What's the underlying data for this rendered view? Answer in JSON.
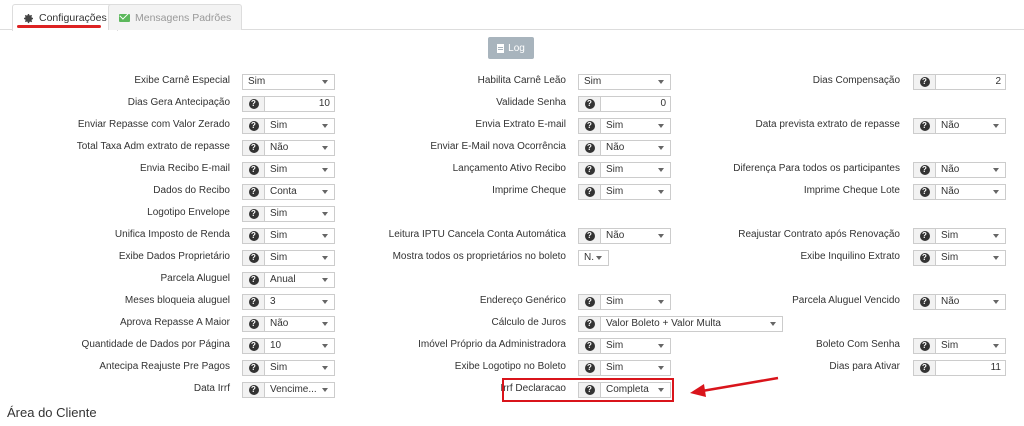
{
  "tabs": [
    {
      "label": "Configurações",
      "active": true
    },
    {
      "label": "Mensagens Padrões",
      "active": false
    }
  ],
  "log_button": "Log",
  "section_title": "Área do Cliente",
  "help_glyph": "?",
  "colors": {
    "accent_red": "#d9141b",
    "log_button": "#a8b4bd",
    "mail_green": "#5cb85c"
  },
  "rows": [
    [
      {
        "label": "Exibe Carnê Especial",
        "type": "select",
        "value": "Sim",
        "help": false
      },
      {
        "label": "Habilita Carnê Leão",
        "type": "select",
        "value": "Sim",
        "help": false
      },
      {
        "label": "Dias Compensação",
        "type": "number",
        "value": "2",
        "help": true
      }
    ],
    [
      {
        "label": "Dias Gera Antecipação",
        "type": "number",
        "value": "10",
        "help": true
      },
      {
        "label": "Validade Senha",
        "type": "number",
        "value": "0",
        "help": true
      },
      null
    ],
    [
      {
        "label": "Enviar Repasse com Valor Zerado",
        "type": "select",
        "value": "Sim",
        "help": true
      },
      {
        "label": "Envia Extrato E-mail",
        "type": "select",
        "value": "Sim",
        "help": true
      },
      {
        "label": "Data prevista extrato de repasse",
        "type": "select",
        "value": "Não",
        "help": true
      }
    ],
    [
      {
        "label": "Total Taxa Adm extrato de repasse",
        "type": "select",
        "value": "Não",
        "help": true
      },
      {
        "label": "Enviar E-Mail nova Ocorrência",
        "type": "select",
        "value": "Não",
        "help": true
      },
      null
    ],
    [
      {
        "label": "Envia Recibo E-mail",
        "type": "select",
        "value": "Sim",
        "help": true
      },
      {
        "label": "Lançamento Ativo Recibo",
        "type": "select",
        "value": "Sim",
        "help": true
      },
      {
        "label": "Diferença Para todos os participantes",
        "type": "select",
        "value": "Não",
        "help": true
      }
    ],
    [
      {
        "label": "Dados do Recibo",
        "type": "select",
        "value": "Conta",
        "help": true
      },
      {
        "label": "Imprime Cheque",
        "type": "select",
        "value": "Sim",
        "help": true
      },
      {
        "label": "Imprime Cheque Lote",
        "type": "select",
        "value": "Não",
        "help": true
      }
    ],
    [
      {
        "label": "Logotipo Envelope",
        "type": "select",
        "value": "Sim",
        "help": true
      },
      null,
      null
    ],
    [
      {
        "label": "Unifica Imposto de Renda",
        "type": "select",
        "value": "Sim",
        "help": true
      },
      {
        "label": "Leitura IPTU Cancela Conta Automática",
        "type": "select",
        "value": "Não",
        "help": true
      },
      {
        "label": "Reajustar Contrato após Renovação",
        "type": "select",
        "value": "Sim",
        "help": true
      }
    ],
    [
      {
        "label": "Exibe Dados Proprietário",
        "type": "select",
        "value": "Sim",
        "help": true
      },
      {
        "label": "Mostra todos os proprietários no boleto",
        "type": "select",
        "value": "N.",
        "help": false,
        "narrow": true
      },
      {
        "label": "Exibe Inquilino Extrato",
        "type": "select",
        "value": "Sim",
        "help": true
      }
    ],
    [
      {
        "label": "Parcela Aluguel",
        "type": "select",
        "value": "Anual",
        "help": true
      },
      null,
      null
    ],
    [
      {
        "label": "Meses bloqueia aluguel",
        "type": "select",
        "value": "3",
        "help": true
      },
      {
        "label": "Endereço Genérico",
        "type": "select",
        "value": "Sim",
        "help": true
      },
      {
        "label": "Parcela Aluguel Vencido",
        "type": "select",
        "value": "Não",
        "help": true
      }
    ],
    [
      {
        "label": "Aprova Repasse A Maior",
        "type": "select",
        "value": "Não",
        "help": true
      },
      {
        "label": "Cálculo de Juros",
        "type": "select",
        "value": "Valor Boleto + Valor Multa",
        "help": true,
        "wide": true
      },
      null
    ],
    [
      {
        "label": "Quantidade de Dados por Página",
        "type": "select",
        "value": "10",
        "help": true
      },
      {
        "label": "Imóvel Próprio da Administradora",
        "type": "select",
        "value": "Sim",
        "help": true
      },
      {
        "label": "Boleto Com Senha",
        "type": "select",
        "value": "Sim",
        "help": true
      }
    ],
    [
      {
        "label": "Antecipa Reajuste Pre Pagos",
        "type": "select",
        "value": "Sim",
        "help": true
      },
      {
        "label": "Exibe Logotipo no Boleto",
        "type": "select",
        "value": "Sim",
        "help": true
      },
      {
        "label": "Dias para Ativar",
        "type": "number",
        "value": "11",
        "help": true
      }
    ],
    [
      {
        "label": "Data Irrf",
        "type": "select",
        "value": "Vencime...",
        "help": true
      },
      {
        "label": "Irrf Declaracao",
        "type": "select",
        "value": "Completa",
        "help": true
      },
      null
    ]
  ]
}
